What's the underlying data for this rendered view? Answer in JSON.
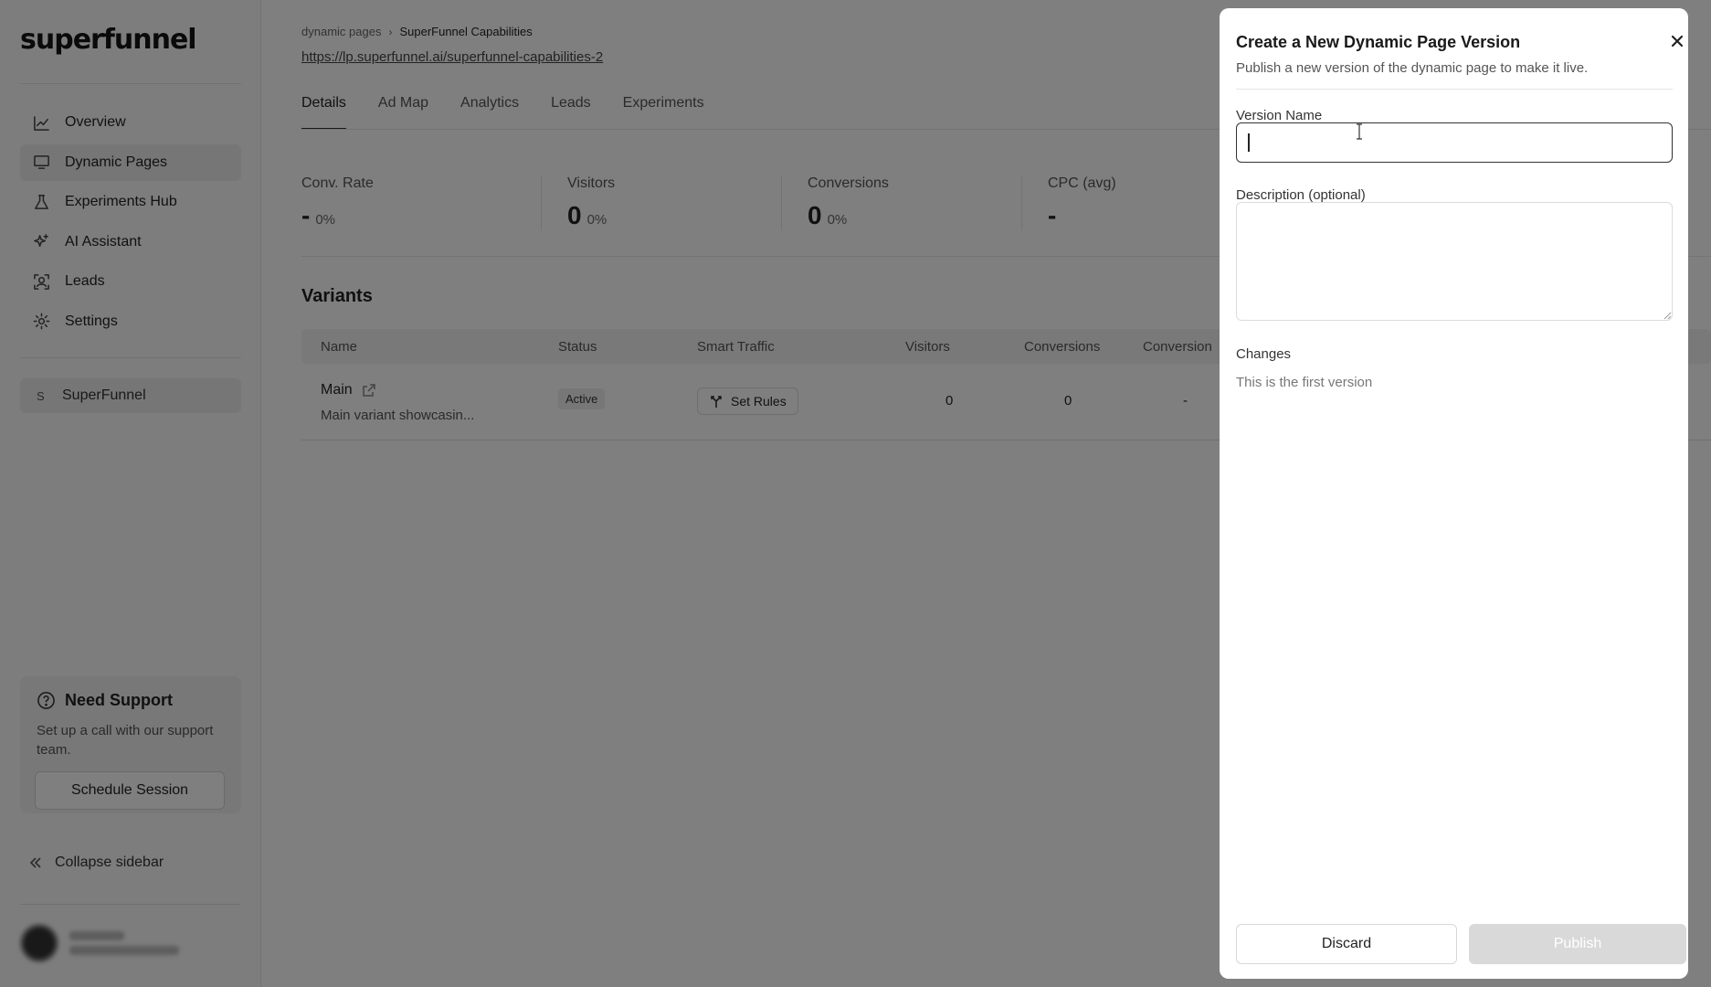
{
  "sidebar": {
    "logo": "superfunnel",
    "nav": [
      {
        "label": "Overview",
        "icon": "chart-line-icon"
      },
      {
        "label": "Dynamic Pages",
        "icon": "monitor-icon"
      },
      {
        "label": "Experiments Hub",
        "icon": "flask-icon"
      },
      {
        "label": "AI Assistant",
        "icon": "sparkles-icon"
      },
      {
        "label": "Leads",
        "icon": "user-focus-icon"
      },
      {
        "label": "Settings",
        "icon": "gear-icon"
      }
    ],
    "active_nav": "Dynamic Pages",
    "workspace": {
      "initial": "S",
      "name": "SuperFunnel"
    },
    "support": {
      "title": "Need Support",
      "text": "Set up a call with our support team.",
      "button": "Schedule Session"
    },
    "collapse_label": "Collapse sidebar"
  },
  "main": {
    "breadcrumb": {
      "parent": "dynamic pages",
      "current": "SuperFunnel Capabilities"
    },
    "url": "https://lp.superfunnel.ai/superfunnel-capabilities-2",
    "tabs": [
      "Details",
      "Ad Map",
      "Analytics",
      "Leads",
      "Experiments"
    ],
    "active_tab": "Details",
    "stats": [
      {
        "label": "Conv. Rate",
        "value": "-",
        "pct": "0%"
      },
      {
        "label": "Visitors",
        "value": "0",
        "pct": "0%"
      },
      {
        "label": "Conversions",
        "value": "0",
        "pct": "0%"
      },
      {
        "label": "CPC (avg)",
        "value": "-",
        "pct": ""
      }
    ],
    "variants_title": "Variants",
    "table": {
      "headers": [
        "Name",
        "Status",
        "Smart Traffic",
        "Visitors",
        "Conversions",
        "Conversion"
      ],
      "rows": [
        {
          "name": "Main",
          "description": "Main variant showcasin...",
          "status": "Active",
          "smart_traffic": "Set Rules",
          "visitors": "0",
          "conversions": "0",
          "conversion": "-"
        }
      ]
    }
  },
  "drawer": {
    "title": "Create a New Dynamic Page Version",
    "subtitle": "Publish a new version of the dynamic page to make it live.",
    "version_name_label": "Version Name",
    "version_name_value": "",
    "description_label": "Description (optional)",
    "description_value": "",
    "changes_label": "Changes",
    "changes_text": "This is the first version",
    "discard_label": "Discard",
    "publish_label": "Publish"
  },
  "colors": {
    "overlay": "#00000080",
    "publish_disabled": "#d9d9d9",
    "active_nav_bg": "#ececec"
  }
}
